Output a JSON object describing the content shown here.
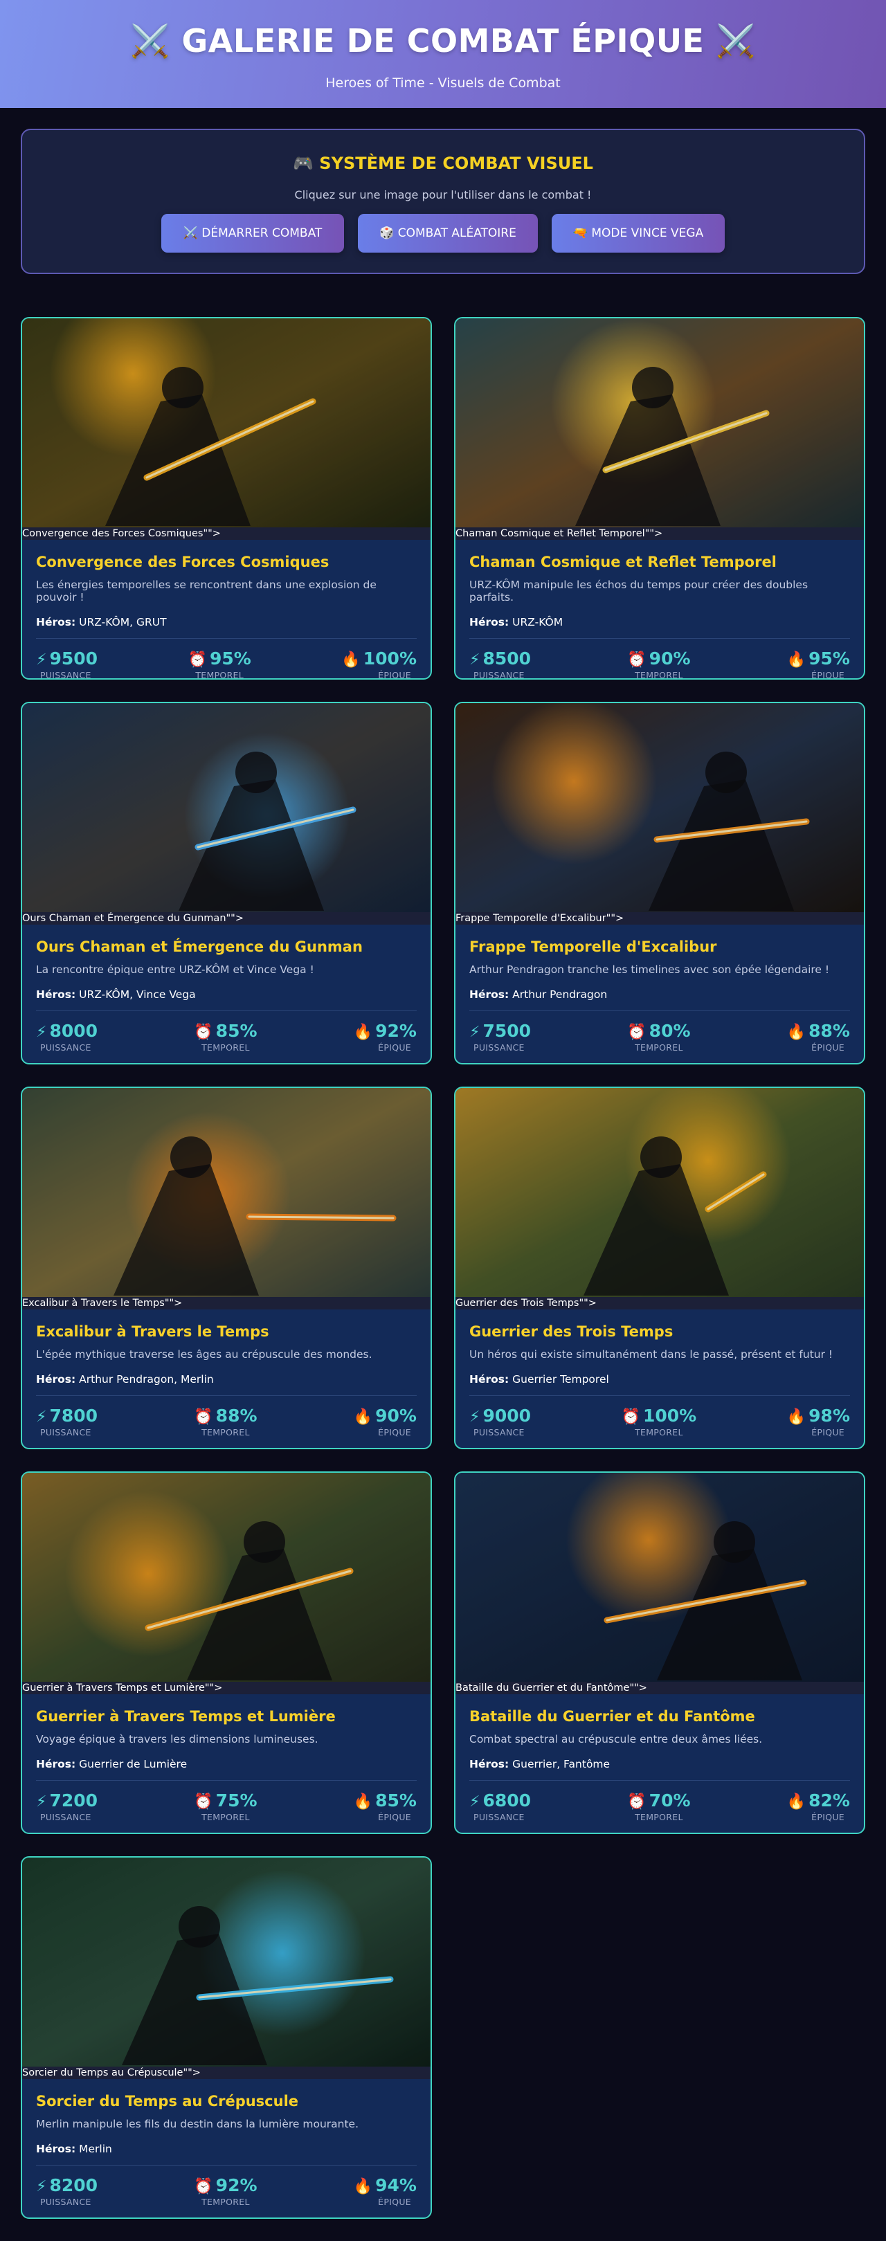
{
  "header": {
    "title": "⚔️ GALERIE DE COMBAT ÉPIQUE ⚔️",
    "subtitle": "Heroes of Time - Visuels de Combat"
  },
  "panel": {
    "title": "🎮 SYSTÈME DE COMBAT VISUEL",
    "hint": "Cliquez sur une image pour l'utiliser dans le combat !",
    "buttons": [
      "⚔️ DÉMARRER COMBAT",
      "🎲 COMBAT ALÉATOIRE",
      "🔫 MODE VINCE VEGA"
    ]
  },
  "stat_labels": {
    "power": "PUISSANCE",
    "temporal": "TEMPOREL",
    "epic": "ÉPIQUE"
  },
  "stat_icons": {
    "power": "⚡",
    "temporal": "⏰",
    "epic": "🔥"
  },
  "heroes_prefix": "Héros:",
  "cards": [
    {
      "alt": "Convergence des Forces Cosmiques\"\">",
      "title": "Convergence des Forces Cosmiques",
      "desc": "Les énergies temporelles se rencontrent dans une explosion de pouvoir !",
      "heroes": "URZ-KÔM, GRUT",
      "power": "9500",
      "temporal": "95%",
      "epic": "100%",
      "palette": [
        "#3a3a16",
        "#5a4a1a",
        "#1f2410"
      ],
      "glow": "#ffb21e"
    },
    {
      "alt": "Chaman Cosmique et Reflet Temporel\"\">",
      "title": "Chaman Cosmique et Reflet Temporel",
      "desc": "URZ-KÔM manipule les échos du temps pour créer des doubles parfaits.",
      "heroes": "URZ-KÔM",
      "power": "8500",
      "temporal": "90%",
      "epic": "95%",
      "palette": [
        "#2b4a52",
        "#6a4a26",
        "#1c2d33"
      ],
      "glow": "#ffcf3a"
    },
    {
      "alt": "Ours Chaman et Émergence du Gunman\"\">",
      "title": "Ours Chaman et Émergence du Gunman",
      "desc": "La rencontre épique entre URZ-KÔM et Vince Vega !",
      "heroes": "URZ-KÔM, Vince Vega",
      "power": "8000",
      "temporal": "85%",
      "epic": "92%",
      "palette": [
        "#1d3350",
        "#3b3a3a",
        "#132238"
      ],
      "glow": "#4fb8ff"
    },
    {
      "alt": "Frappe Temporelle d'Excalibur\"\">",
      "title": "Frappe Temporelle d'Excalibur",
      "desc": "Arthur Pendragon tranche les timelines avec son épée légendaire !",
      "heroes": "Arthur Pendragon",
      "power": "7500",
      "temporal": "80%",
      "epic": "88%",
      "palette": [
        "#3a2414",
        "#24324a",
        "#1a1410"
      ],
      "glow": "#ff9a20"
    },
    {
      "alt": "Excalibur à Travers le Temps\"\">",
      "title": "Excalibur à Travers le Temps",
      "desc": "L'épée mythique traverse les âges au crépuscule des mondes.",
      "heroes": "Arthur Pendragon, Merlin",
      "power": "7800",
      "temporal": "88%",
      "epic": "90%",
      "palette": [
        "#3a4a3a",
        "#7a6a3a",
        "#2a3a3a"
      ],
      "glow": "#ff8a1a"
    },
    {
      "alt": "Guerrier des Trois Temps\"\">",
      "title": "Guerrier des Trois Temps",
      "desc": "Un héros qui existe simultanément dans le passé, présent et futur !",
      "heroes": "Guerrier Temporel",
      "power": "9000",
      "temporal": "100%",
      "epic": "98%",
      "palette": [
        "#b58a2a",
        "#4a5a2a",
        "#2a3a22"
      ],
      "glow": "#ffb01a"
    },
    {
      "alt": "Guerrier à Travers Temps et Lumière\"\">",
      "title": "Guerrier à Travers Temps et Lumière",
      "desc": "Voyage épique à travers les dimensions lumineuses.",
      "heroes": "Guerrier de Lumière",
      "power": "7200",
      "temporal": "75%",
      "epic": "85%",
      "palette": [
        "#8a6a2a",
        "#3a4a2a",
        "#242a1a"
      ],
      "glow": "#ffa01a"
    },
    {
      "alt": "Bataille du Guerrier et du Fantôme\"\">",
      "title": "Bataille du Guerrier et du Fantôme",
      "desc": "Combat spectral au crépuscule entre deux âmes liées.",
      "heroes": "Guerrier, Fantôme",
      "power": "6800",
      "temporal": "70%",
      "epic": "82%",
      "palette": [
        "#1a3050",
        "#14243e",
        "#0e1a2e"
      ],
      "glow": "#ff9a1a"
    },
    {
      "alt": "Sorcier du Temps au Crépuscule\"\">",
      "title": "Sorcier du Temps au Crépuscule",
      "desc": "Merlin manipule les fils du destin dans la lumière mourante.",
      "heroes": "Merlin",
      "power": "8200",
      "temporal": "92%",
      "epic": "94%",
      "palette": [
        "#1a3a2a",
        "#2a4a3a",
        "#0e1e18"
      ],
      "glow": "#40c8ff"
    }
  ]
}
